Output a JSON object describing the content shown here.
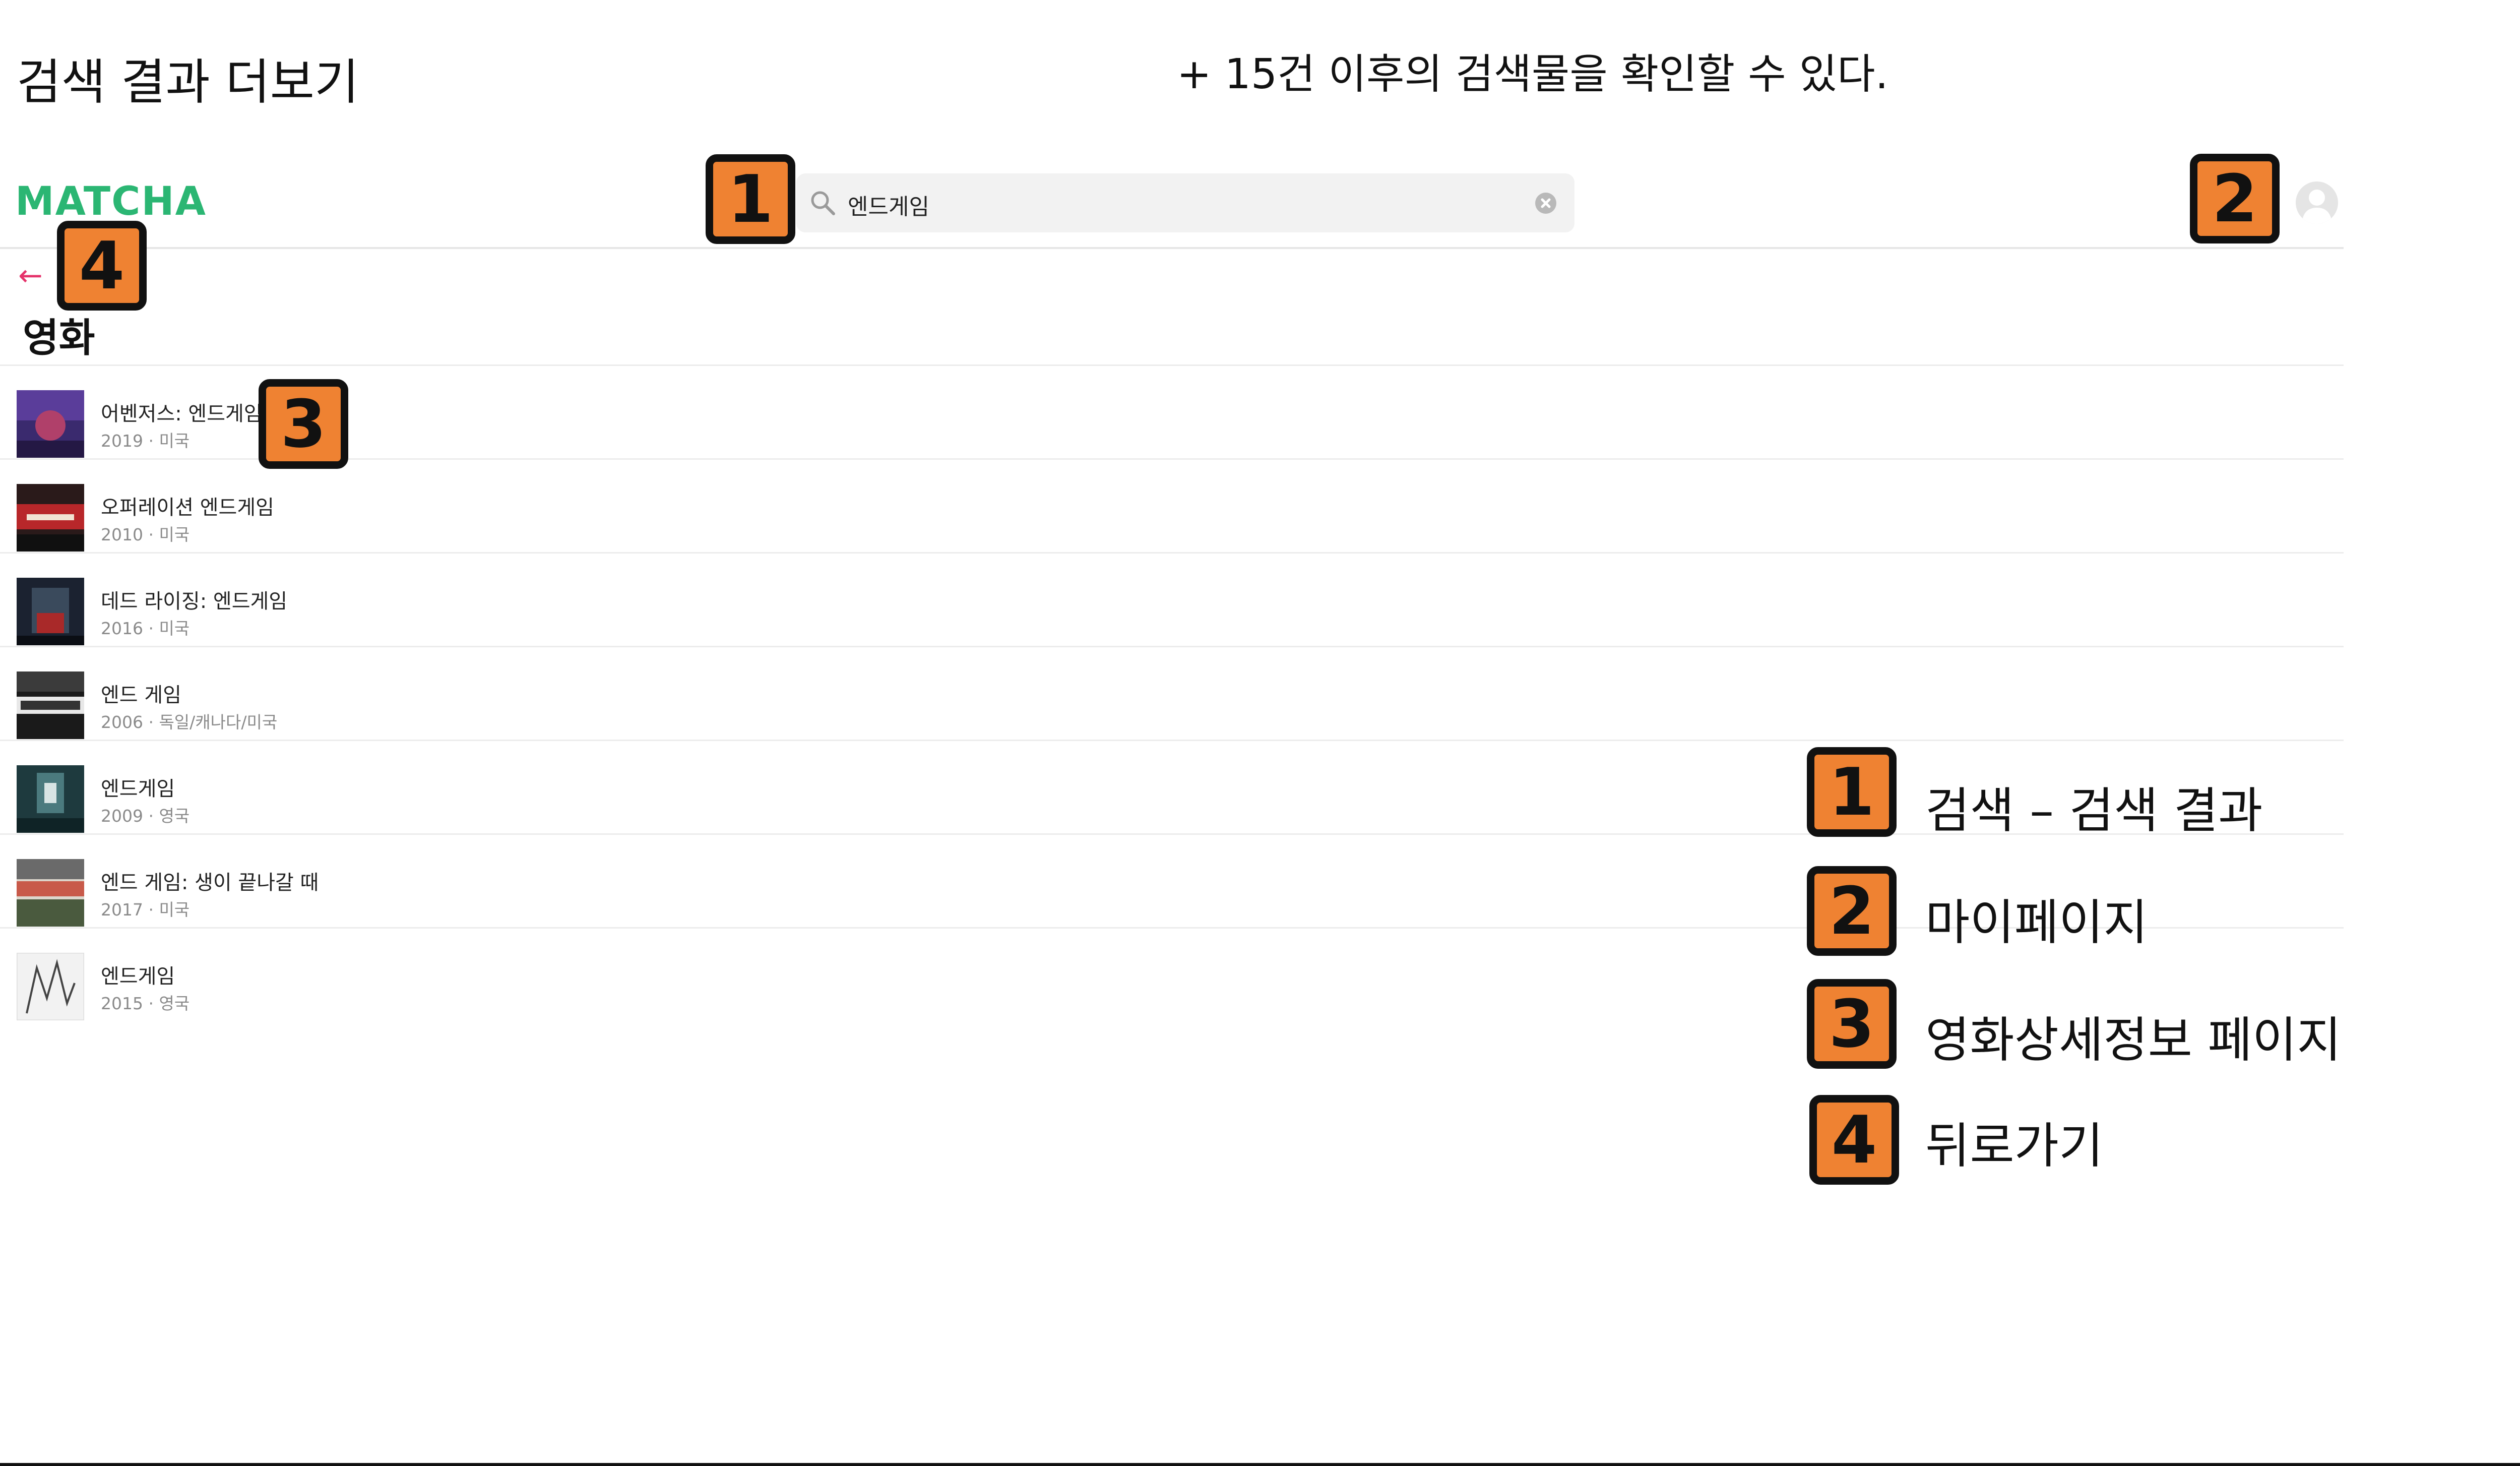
{
  "page_heading": "검색 결과 더보기",
  "top_note": "+ 15건 이후의 검색물을 확인할 수 있다.",
  "header": {
    "logo": "MATCHA",
    "search_value": "엔드게임"
  },
  "back_label": "←",
  "section_title": "영화",
  "movies": [
    {
      "title": "어벤저스: 엔드게임",
      "meta": "2019 · 미국"
    },
    {
      "title": "오퍼레이션 엔드게임",
      "meta": "2010 · 미국"
    },
    {
      "title": "데드 라이징: 엔드게임",
      "meta": "2016 · 미국"
    },
    {
      "title": "엔드 게임",
      "meta": "2006 · 독일/캐나다/미국"
    },
    {
      "title": "엔드게임",
      "meta": "2009 · 영국"
    },
    {
      "title": "엔드 게임: 생이 끝나갈 때",
      "meta": "2017 · 미국"
    },
    {
      "title": "엔드게임",
      "meta": "2015 · 영국"
    }
  ],
  "badges": {
    "b1": "1",
    "b2": "2",
    "b3": "3",
    "b4": "4"
  },
  "legend": [
    {
      "number": "1",
      "text": "검색 – 검색 결과"
    },
    {
      "number": "2",
      "text": "마이페이지"
    },
    {
      "number": "3",
      "text": "영화상세정보 페이지"
    },
    {
      "number": "4",
      "text": "뒤로가기"
    }
  ],
  "colors": {
    "logo": "#2bb673",
    "back_arrow": "#e5336b",
    "badge": "#ef8232"
  }
}
